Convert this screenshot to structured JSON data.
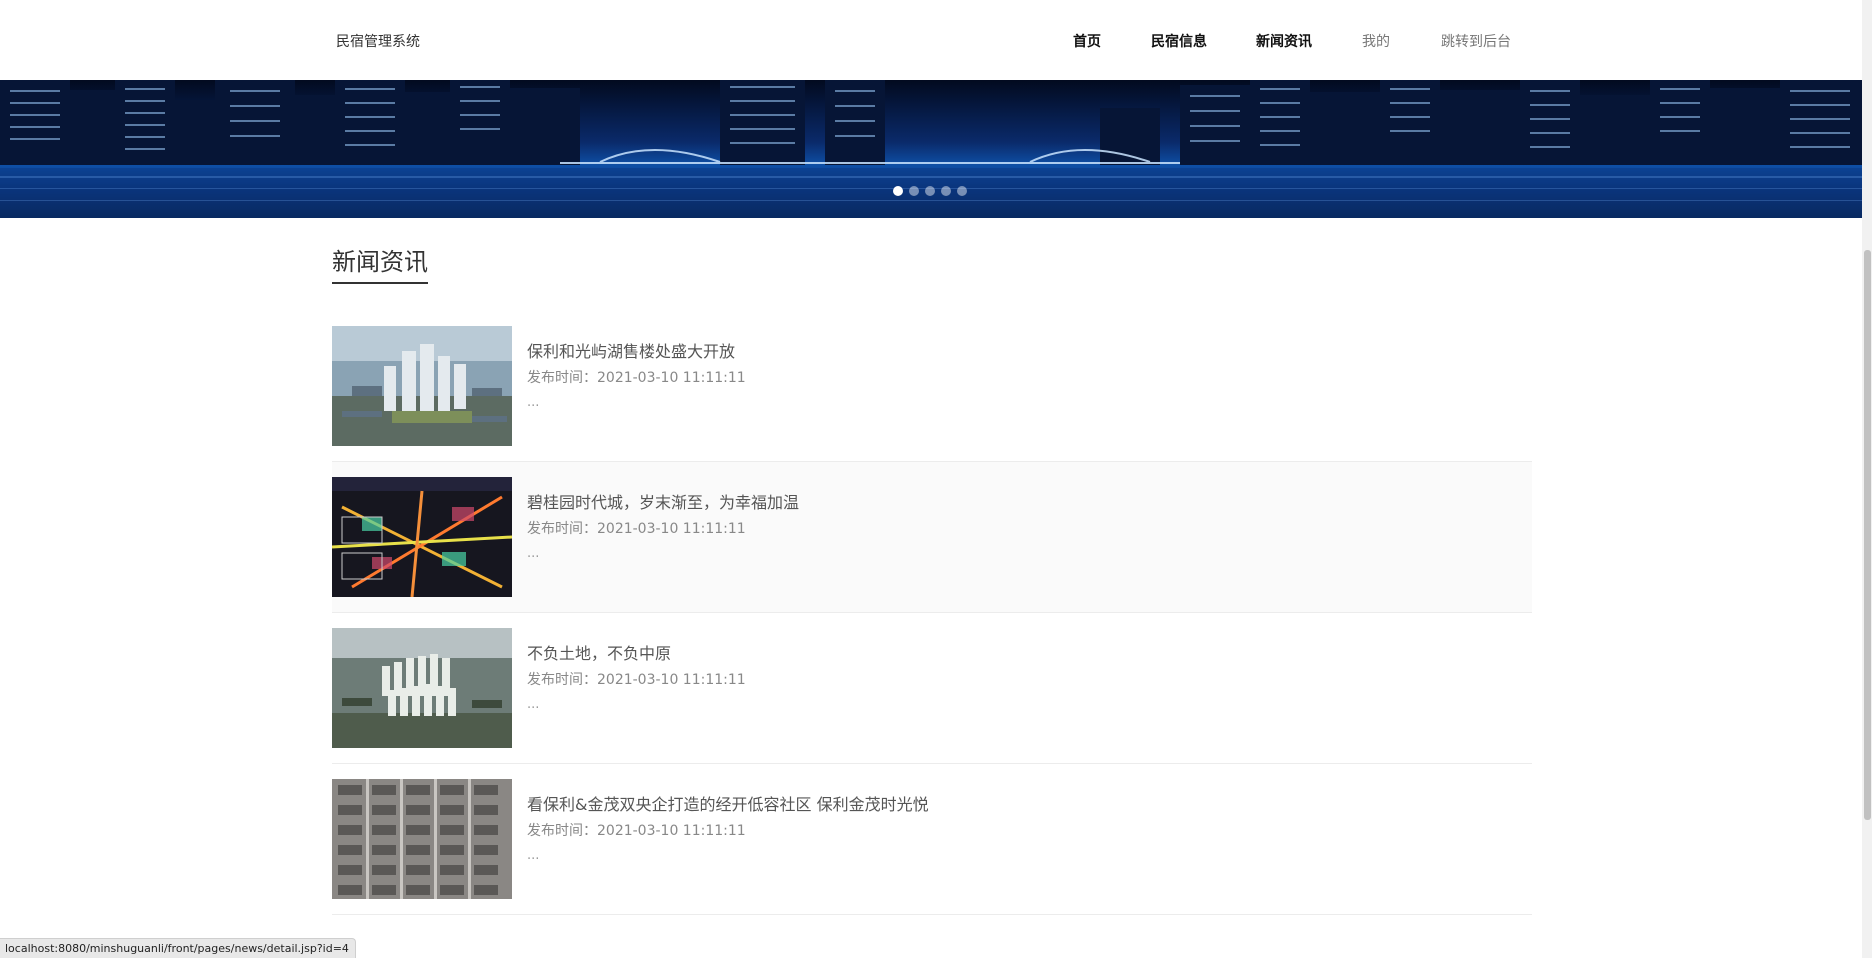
{
  "header": {
    "brand": "民宿管理系统",
    "nav": [
      {
        "label": "首页",
        "style": "bold"
      },
      {
        "label": "民宿信息",
        "style": "bold"
      },
      {
        "label": "新闻资讯",
        "style": "bold"
      },
      {
        "label": "我的",
        "style": "light"
      },
      {
        "label": "跳转到后台",
        "style": "light"
      }
    ]
  },
  "banner": {
    "slide_count": 5,
    "active_slide": 1
  },
  "section": {
    "title": "新闻资讯"
  },
  "news": {
    "meta_label": "发布时间：",
    "items": [
      {
        "title": "保利和光屿湖售楼处盛大开放",
        "date": "2021-03-10 11:11:11",
        "excerpt": "...",
        "thumb": "aerial-towers-icon"
      },
      {
        "title": "碧桂园时代城，岁末渐至，为幸福加温",
        "date": "2021-03-10 11:11:11",
        "excerpt": "...",
        "thumb": "night-map-icon"
      },
      {
        "title": "不负土地，不负中原",
        "date": "2021-03-10 11:11:11",
        "excerpt": "...",
        "thumb": "aerial-community-icon"
      },
      {
        "title": "看保利&金茂双央企打造的经开低容社区 保利金茂时光悦",
        "date": "2021-03-10 11:11:11",
        "excerpt": "...",
        "thumb": "apartment-facade-icon"
      }
    ]
  },
  "status": {
    "url": "localhost:8080/minshuguanli/front/pages/news/detail.jsp?id=4"
  },
  "colors": {
    "text_primary": "#333333",
    "text_muted": "#888888",
    "banner_blue": "#0e4fa6"
  }
}
